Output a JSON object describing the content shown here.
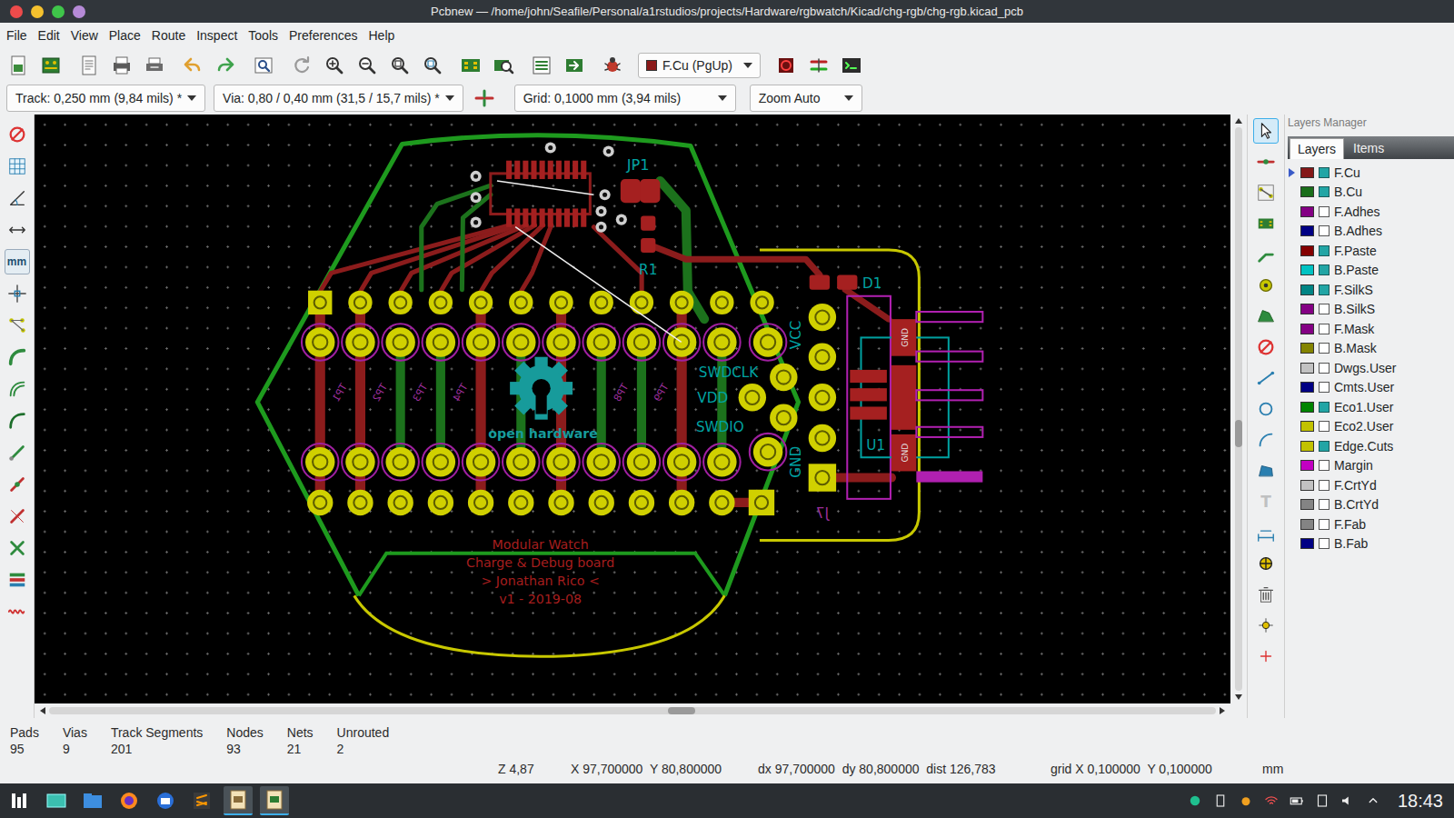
{
  "window": {
    "title": "Pcbnew — /home/john/Seafile/Personal/a1rstudios/projects/Hardware/rgbwatch/Kicad/chg-rgb/chg-rgb.kicad_pcb",
    "buttons": [
      {
        "color": "#ed4b4b"
      },
      {
        "color": "#f5c12e"
      },
      {
        "color": "#3fc54a"
      },
      {
        "color": "#b58ad6"
      }
    ]
  },
  "menu": [
    "File",
    "Edit",
    "View",
    "Place",
    "Route",
    "Inspect",
    "Tools",
    "Preferences",
    "Help"
  ],
  "toolbar": {
    "layer": "F.Cu (PgUp)",
    "layer_color": "#8b1a1a"
  },
  "options": {
    "track": "Track: 0,250 mm (9,84 mils) *",
    "via": "Via: 0,80 / 0,40 mm (31,5 / 15,7 mils) *",
    "grid": "Grid: 0,1000 mm (3,94 mils)",
    "zoom": "Zoom Auto"
  },
  "left_toolbar": {
    "units_label": "mm"
  },
  "right_toolbar": {
    "tools": [
      {
        "selected": true,
        "disabled": false
      },
      {
        "selected": false,
        "disabled": false
      },
      {
        "selected": false,
        "disabled": false
      },
      {
        "selected": false,
        "disabled": false
      },
      {
        "selected": false,
        "disabled": false
      },
      {
        "selected": false,
        "disabled": false
      },
      {
        "selected": false,
        "disabled": false
      },
      {
        "selected": false,
        "disabled": false
      },
      {
        "selected": false,
        "disabled": false
      },
      {
        "selected": false,
        "disabled": false
      },
      {
        "selected": false,
        "disabled": false
      },
      {
        "selected": false,
        "disabled": false
      },
      {
        "selected": false,
        "disabled": true,
        "glyph": "T"
      },
      {
        "selected": false,
        "disabled": false
      },
      {
        "selected": false,
        "disabled": false
      },
      {
        "selected": false,
        "disabled": false
      },
      {
        "selected": false,
        "disabled": false
      },
      {
        "selected": false,
        "disabled": false
      }
    ]
  },
  "board": {
    "labels": [
      {
        "text": "JP1",
        "color": "#00a3a3"
      },
      {
        "text": "R1",
        "color": "#00a3a3"
      },
      {
        "text": "D1",
        "color": "#00a3a3"
      },
      {
        "text": "U1",
        "color": "#00a3a3"
      },
      {
        "text": "SWDCLK",
        "color": "#00a3a3"
      },
      {
        "text": "VDD",
        "color": "#00a3a3"
      },
      {
        "text": "SWDIO",
        "color": "#00a3a3"
      },
      {
        "text": "VCC",
        "color": "#00a3a3"
      },
      {
        "text": "GND",
        "color": "#00a3a3"
      },
      {
        "text": "J7",
        "color": "#9a2e9a"
      },
      {
        "text": "GND",
        "color": "#e6e6e6"
      },
      {
        "text": "GND",
        "color": "#e6e6e6"
      }
    ],
    "notes": [
      "Modular Watch",
      "Charge & Debug board",
      "> Jonathan Rico <",
      "v1 - 2019-08"
    ],
    "logo_caption": "open hardware",
    "test_points": [
      "TP1",
      "TP2",
      "TP3",
      "TP4",
      "TP8",
      "TP9"
    ]
  },
  "scrollbars": {
    "horizontal": 0.53,
    "vertical": 0.52
  },
  "layers_manager": {
    "title": "Layers Manager",
    "tabs": [
      {
        "label": "Layers",
        "selected": true
      },
      {
        "label": "Items",
        "selected": false
      }
    ],
    "layers": [
      {
        "name": "F.Cu",
        "color": "#841818",
        "visible": true,
        "selected": true
      },
      {
        "name": "B.Cu",
        "color": "#1a6e1a",
        "visible": true,
        "selected": false
      },
      {
        "name": "F.Adhes",
        "color": "#840084",
        "visible": false,
        "selected": false
      },
      {
        "name": "B.Adhes",
        "color": "#000084",
        "visible": false,
        "selected": false
      },
      {
        "name": "F.Paste",
        "color": "#840000",
        "visible": true,
        "selected": false
      },
      {
        "name": "B.Paste",
        "color": "#00c2c2",
        "visible": true,
        "selected": false
      },
      {
        "name": "F.SilkS",
        "color": "#008484",
        "visible": true,
        "selected": false
      },
      {
        "name": "B.SilkS",
        "color": "#840084",
        "visible": false,
        "selected": false
      },
      {
        "name": "F.Mask",
        "color": "#840084",
        "visible": false,
        "selected": false
      },
      {
        "name": "B.Mask",
        "color": "#848400",
        "visible": false,
        "selected": false
      },
      {
        "name": "Dwgs.User",
        "color": "#c2c2c2",
        "visible": false,
        "selected": false
      },
      {
        "name": "Cmts.User",
        "color": "#000084",
        "visible": false,
        "selected": false
      },
      {
        "name": "Eco1.User",
        "color": "#008400",
        "visible": true,
        "selected": false
      },
      {
        "name": "Eco2.User",
        "color": "#c2c200",
        "visible": false,
        "selected": false
      },
      {
        "name": "Edge.Cuts",
        "color": "#c2c200",
        "visible": true,
        "selected": false
      },
      {
        "name": "Margin",
        "color": "#c200c2",
        "visible": false,
        "selected": false
      },
      {
        "name": "F.CrtYd",
        "color": "#c2c2c2",
        "visible": false,
        "selected": false
      },
      {
        "name": "B.CrtYd",
        "color": "#848484",
        "visible": false,
        "selected": false
      },
      {
        "name": "F.Fab",
        "color": "#848484",
        "visible": false,
        "selected": false
      },
      {
        "name": "B.Fab",
        "color": "#000084",
        "visible": false,
        "selected": false
      }
    ]
  },
  "status": {
    "counts": [
      {
        "label": "Pads",
        "value": "95"
      },
      {
        "label": "Vias",
        "value": "9"
      },
      {
        "label": "Track Segments",
        "value": "201"
      },
      {
        "label": "Nodes",
        "value": "93"
      },
      {
        "label": "Nets",
        "value": "21"
      },
      {
        "label": "Unrouted",
        "value": "2"
      }
    ],
    "zoom": "Z 4,87",
    "cursor": "X 97,700000  Y 80,800000",
    "delta": "dx 97,700000  dy 80,800000  dist 126,783",
    "grid": "grid X 0,100000  Y 0,100000",
    "units": "mm"
  },
  "taskbar": {
    "clock": "18:43"
  }
}
